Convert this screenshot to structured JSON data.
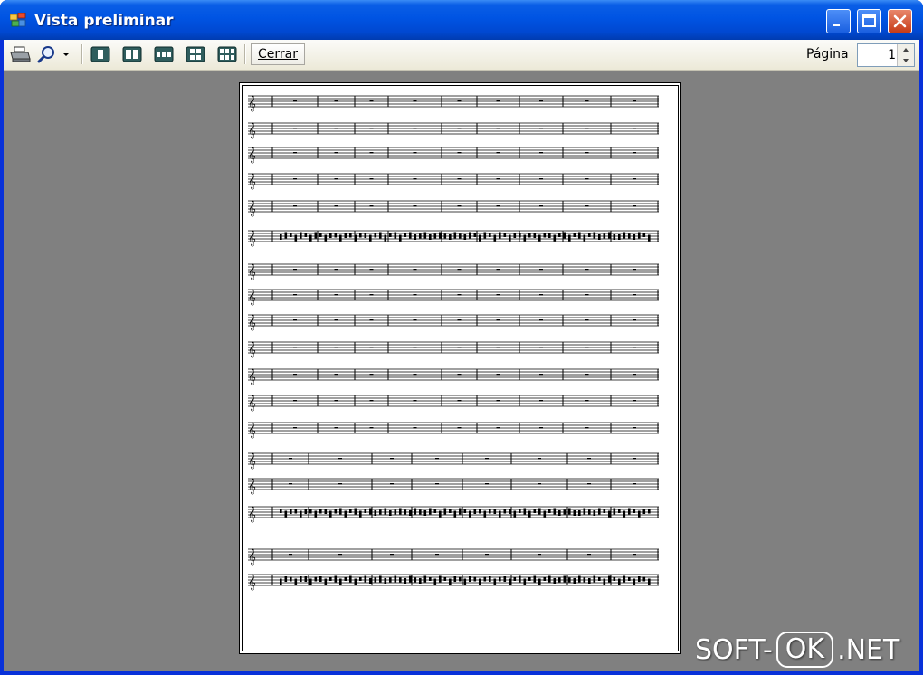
{
  "window": {
    "title": "Vista preliminar",
    "colors": {
      "titlebar": "#0054e3",
      "preview_bg": "#808080",
      "close": "#c73b17"
    }
  },
  "toolbar": {
    "print_icon": "printer-icon",
    "zoom_icon": "magnifier-icon",
    "layout_icons": [
      "one-page-icon",
      "two-pages-icon",
      "three-pages-icon",
      "four-pages-icon",
      "six-pages-icon"
    ],
    "close_label": "Cerrar",
    "page_label": "Página",
    "page_value": "1"
  },
  "watermark": {
    "left": "SOFT-",
    "middle": "OK",
    "right": ".NET"
  }
}
